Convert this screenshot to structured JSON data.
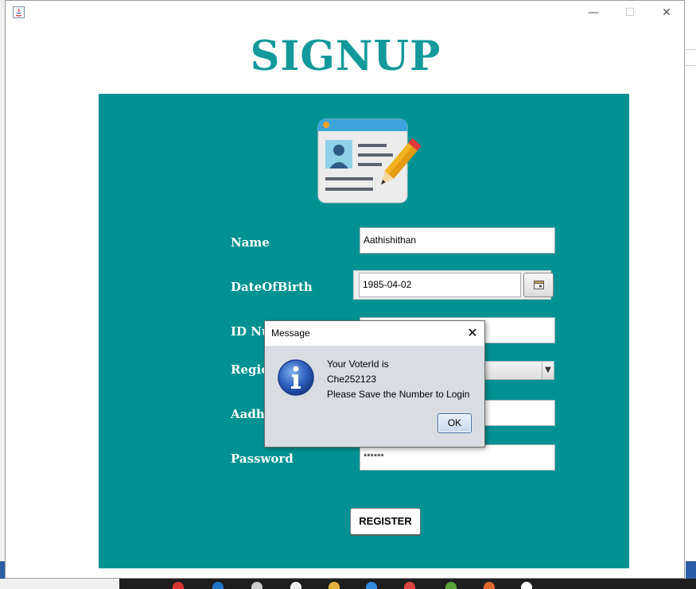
{
  "window": {
    "minimize": "—",
    "maximize": "☐",
    "close": "✕"
  },
  "page": {
    "title": "SIGNUP"
  },
  "form": {
    "name_label": "Name",
    "name_value": "Aathishithan",
    "dob_label": "DateOfBirth",
    "dob_value": "1985-04-02",
    "id_label": "ID Number",
    "region_label": "Region",
    "aadhaar_label": "Aadhaar",
    "password_label": "Password",
    "password_value": "******",
    "register_label": "REGISTER"
  },
  "dialog": {
    "title": "Message",
    "close": "✕",
    "line1": "Your VoterId is",
    "line2": "Che252123",
    "line3": "Please Save the Number to Login",
    "ok_label": "OK"
  },
  "colors": {
    "panel": "#009292",
    "title": "#12999b"
  }
}
